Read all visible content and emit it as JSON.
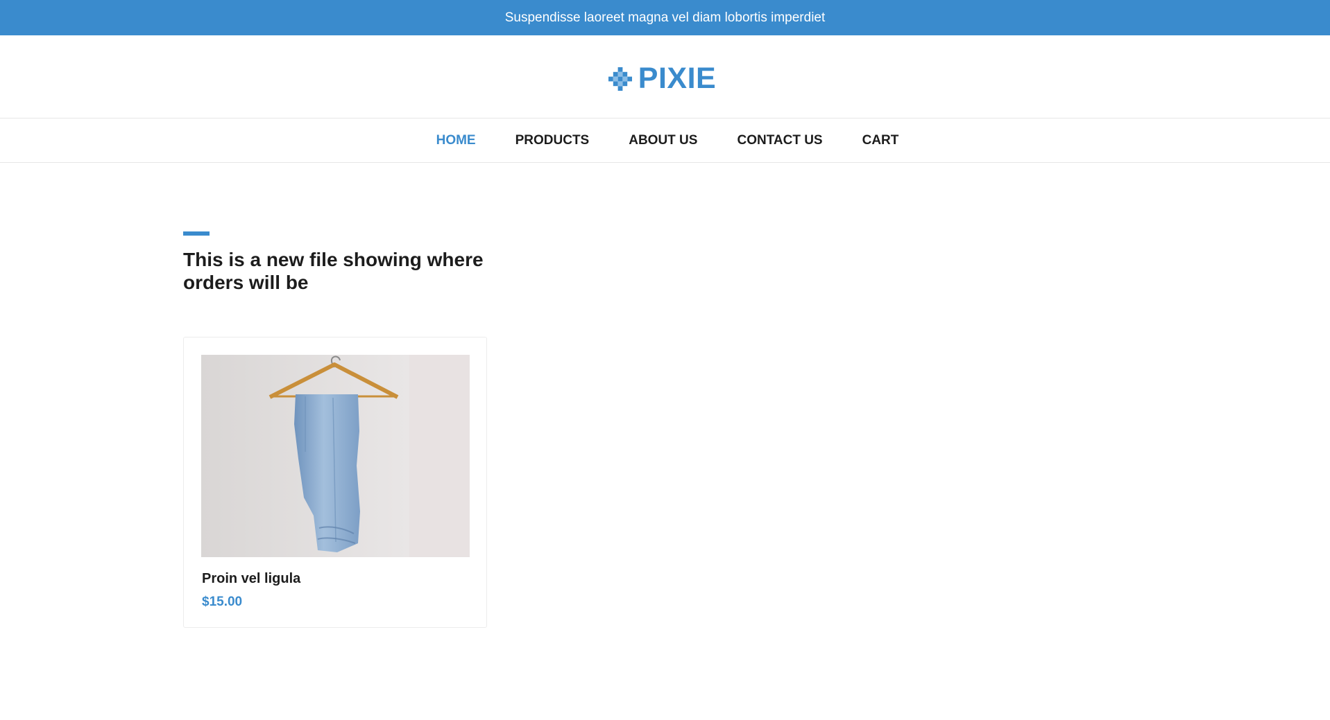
{
  "announcement": {
    "text": "Suspendisse laoreet magna vel diam lobortis imperdiet"
  },
  "brand": {
    "name": "PIXIE",
    "icon": "pixel-diamond-icon",
    "color": "#3a8bcd"
  },
  "nav": {
    "items": [
      {
        "label": "HOME",
        "active": true
      },
      {
        "label": "PRODUCTS",
        "active": false
      },
      {
        "label": "ABOUT US",
        "active": false
      },
      {
        "label": "CONTACT US",
        "active": false
      },
      {
        "label": "CART",
        "active": false
      }
    ]
  },
  "main": {
    "title": "This is a new file showing where orders will be"
  },
  "products": [
    {
      "name": "Proin vel ligula",
      "price": "$15.00",
      "image": "jeans-on-hanger-photo"
    }
  ],
  "colors": {
    "accent": "#3a8bcd",
    "text": "#1c1c1c",
    "border": "#e6e6e6"
  }
}
